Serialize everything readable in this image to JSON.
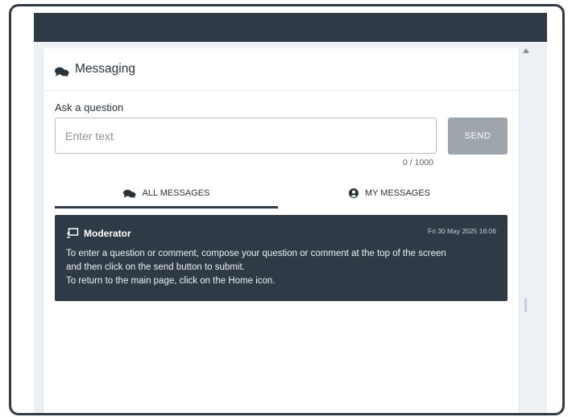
{
  "header": {
    "title": "Messaging",
    "icon": "chat-bubbles-icon"
  },
  "composer": {
    "label": "Ask a question",
    "placeholder": "Enter text",
    "value": "",
    "send_label": "SEND",
    "char_count": "0 / 1000"
  },
  "tabs": [
    {
      "label": "ALL MESSAGES",
      "icon": "chat-bubbles-icon",
      "active": true
    },
    {
      "label": "MY MESSAGES",
      "icon": "user-circle-icon",
      "active": false
    }
  ],
  "messages": [
    {
      "author": "Moderator",
      "icon": "moderator-icon",
      "timestamp": "Fri 30 May 2025 16:06",
      "lines": [
        "To enter a question or comment, compose your question or comment at the top of the screen",
        "and then click on the send button to submit.",
        "To return to the main page, click on the Home icon."
      ]
    }
  ],
  "colors": {
    "topbar": "#2e3b46",
    "card": "#2e3b46",
    "send_disabled": "#9ea5ab",
    "frame": "#2f3a44"
  }
}
